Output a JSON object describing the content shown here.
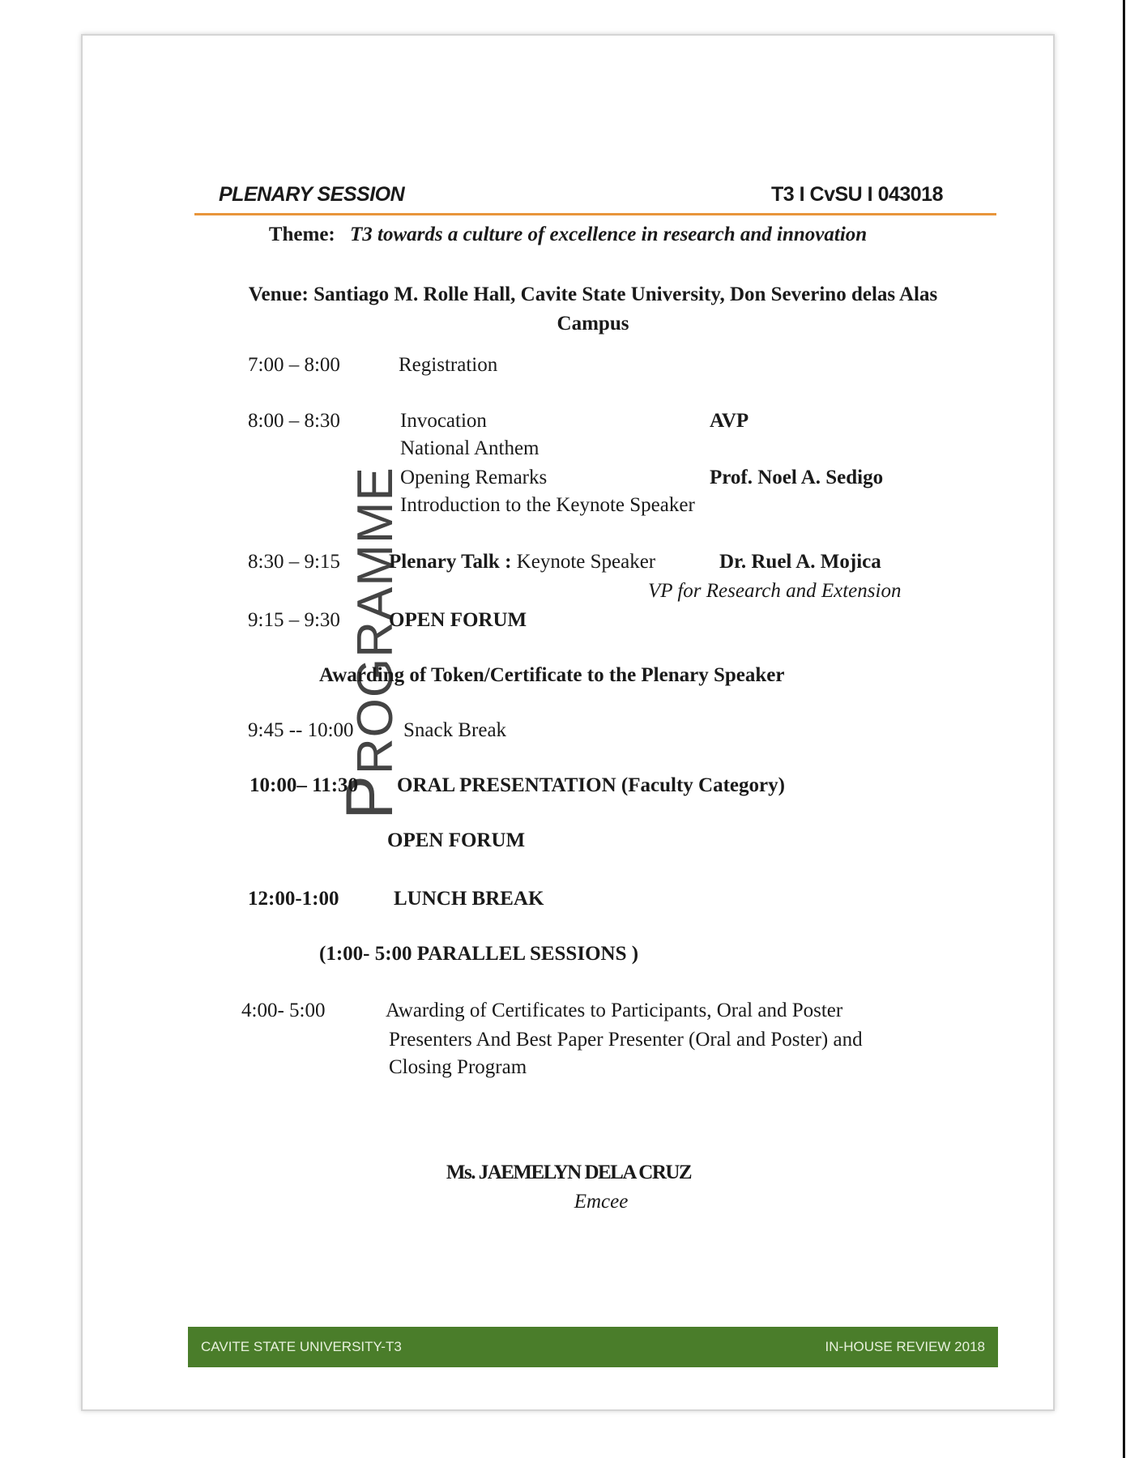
{
  "header": {
    "left": "PLENARY SESSION",
    "right": "T3 I CvSU I 043018",
    "rule_color": "#e8953b"
  },
  "theme": {
    "label": "Theme:",
    "value": "T3 towards a culture of excellence in research and innovation"
  },
  "venue": {
    "line1": "Venue: Santiago M. Rolle Hall, Cavite State University, Don Severino delas Alas",
    "line2": "Campus"
  },
  "side_label": "PROGRAMME",
  "programme": {
    "r1_time": "7:00 – 8:00",
    "r1_item": "Registration",
    "r2_time": "8:00 – 8:30",
    "r2_item1": "Invocation",
    "r2_item1_by": "AVP",
    "r2_item2": "National Anthem",
    "r2_item3": "Opening Remarks",
    "r2_item3_by": "Prof. Noel A. Sedigo",
    "r2_item4": "Introduction to the Keynote Speaker",
    "r3_time": "8:30 – 9:15",
    "r3_item_bold": "Plenary Talk :",
    "r3_item_rest": " Keynote Speaker",
    "r3_by": "Dr. Ruel A. Mojica",
    "r3_by_title": "VP for Research and Extension",
    "r4_time": "9:15 – 9:30",
    "r4_item": "OPEN FORUM",
    "awarding": "Awarding of Token/Certificate to the Plenary Speaker",
    "r5_time": "9:45 -- 10:00",
    "r5_item": "Snack Break",
    "r6_time": "10:00– 11:30",
    "r6_item": "ORAL PRESENTATION (Faculty Category)",
    "r6_forum": "OPEN FORUM",
    "r7_time": "12:00-1:00",
    "r7_item": "LUNCH BREAK",
    "parallel": "(1:00- 5:00  PARALLEL SESSIONS )",
    "r8_time": "4:00- 5:00",
    "r8_line1": "Awarding of Certificates to Participants, Oral and Poster",
    "r8_line2": "Presenters And Best Paper Presenter (Oral and Poster) and",
    "r8_line3": "Closing Program"
  },
  "emcee": {
    "name": "Ms. JAEMELYN DELA CRUZ",
    "role": "Emcee"
  },
  "footer": {
    "left": "CAVITE STATE UNIVERSITY-T3",
    "right": "IN-HOUSE REVIEW 2018",
    "color": "#4a7d2a"
  }
}
